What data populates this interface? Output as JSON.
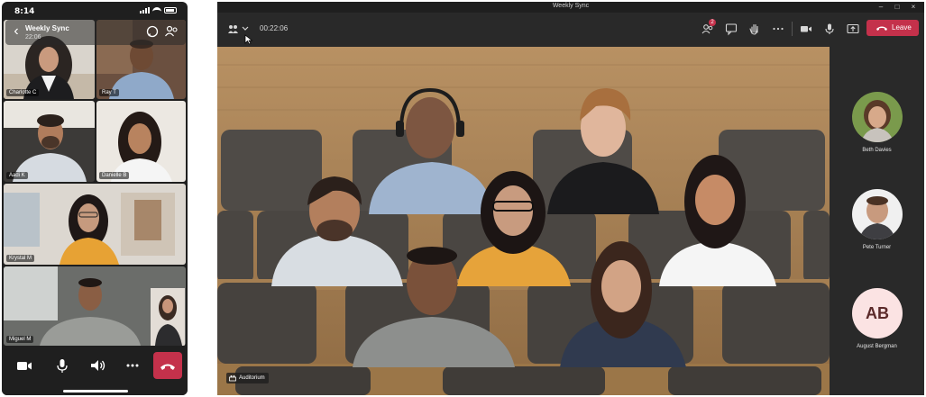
{
  "phone": {
    "status": {
      "time": "8:14"
    },
    "header": {
      "title": "Weekly Sync",
      "duration": "22:06"
    },
    "tiles": [
      {
        "name": "Charlotte C"
      },
      {
        "name": "Ray T"
      },
      {
        "name": "Aadi K"
      },
      {
        "name": "Danielle B"
      },
      {
        "name": "Krystal M"
      },
      {
        "name": "Miguel M"
      }
    ],
    "controls": [
      "video-icon",
      "mic-icon",
      "speaker-icon",
      "more-icon",
      "hang-up-icon"
    ]
  },
  "desktop": {
    "window_title": "Weekly Sync",
    "timer": "00:22:06",
    "participants_badge": "2",
    "leave_label": "Leave",
    "scene_label": "Auditorium",
    "rail": [
      {
        "name": "Beth Davies"
      },
      {
        "name": "Pete Turner"
      },
      {
        "name": "August Bergman",
        "initials": "AB"
      }
    ]
  },
  "colors": {
    "leave": "#c4314b",
    "app_bg": "#292929",
    "seat": "#4e4a46",
    "wood": "#b08a5a"
  }
}
